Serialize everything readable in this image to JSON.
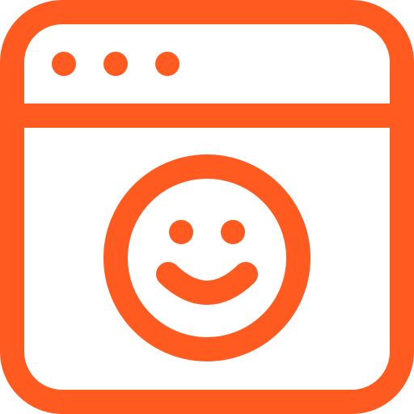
{
  "icon": {
    "name": "browser-window-smiley-icon",
    "accent_color": "#FF5A1F",
    "background_color": "#ffffff",
    "parts": [
      "window-frame-icon",
      "title-bar-divider",
      "window-control-dot-icon",
      "window-control-dot-icon",
      "window-control-dot-icon",
      "smiley-face-icon"
    ]
  }
}
